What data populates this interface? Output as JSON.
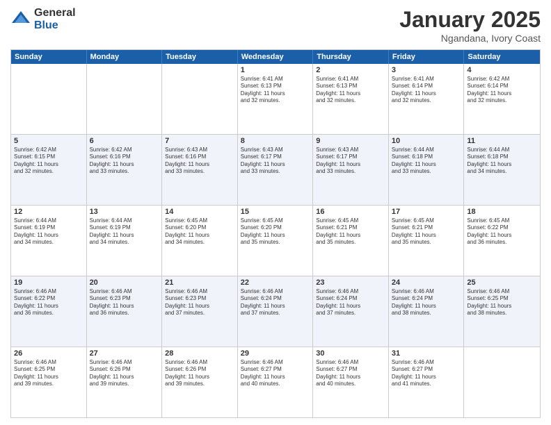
{
  "header": {
    "logo_general": "General",
    "logo_blue": "Blue",
    "month_title": "January 2025",
    "subtitle": "Ngandana, Ivory Coast"
  },
  "calendar": {
    "days_of_week": [
      "Sunday",
      "Monday",
      "Tuesday",
      "Wednesday",
      "Thursday",
      "Friday",
      "Saturday"
    ],
    "rows": [
      [
        {
          "day": "",
          "text": ""
        },
        {
          "day": "",
          "text": ""
        },
        {
          "day": "",
          "text": ""
        },
        {
          "day": "1",
          "text": "Sunrise: 6:41 AM\nSunset: 6:13 PM\nDaylight: 11 hours\nand 32 minutes."
        },
        {
          "day": "2",
          "text": "Sunrise: 6:41 AM\nSunset: 6:13 PM\nDaylight: 11 hours\nand 32 minutes."
        },
        {
          "day": "3",
          "text": "Sunrise: 6:41 AM\nSunset: 6:14 PM\nDaylight: 11 hours\nand 32 minutes."
        },
        {
          "day": "4",
          "text": "Sunrise: 6:42 AM\nSunset: 6:14 PM\nDaylight: 11 hours\nand 32 minutes."
        }
      ],
      [
        {
          "day": "5",
          "text": "Sunrise: 6:42 AM\nSunset: 6:15 PM\nDaylight: 11 hours\nand 32 minutes."
        },
        {
          "day": "6",
          "text": "Sunrise: 6:42 AM\nSunset: 6:16 PM\nDaylight: 11 hours\nand 33 minutes."
        },
        {
          "day": "7",
          "text": "Sunrise: 6:43 AM\nSunset: 6:16 PM\nDaylight: 11 hours\nand 33 minutes."
        },
        {
          "day": "8",
          "text": "Sunrise: 6:43 AM\nSunset: 6:17 PM\nDaylight: 11 hours\nand 33 minutes."
        },
        {
          "day": "9",
          "text": "Sunrise: 6:43 AM\nSunset: 6:17 PM\nDaylight: 11 hours\nand 33 minutes."
        },
        {
          "day": "10",
          "text": "Sunrise: 6:44 AM\nSunset: 6:18 PM\nDaylight: 11 hours\nand 33 minutes."
        },
        {
          "day": "11",
          "text": "Sunrise: 6:44 AM\nSunset: 6:18 PM\nDaylight: 11 hours\nand 34 minutes."
        }
      ],
      [
        {
          "day": "12",
          "text": "Sunrise: 6:44 AM\nSunset: 6:19 PM\nDaylight: 11 hours\nand 34 minutes."
        },
        {
          "day": "13",
          "text": "Sunrise: 6:44 AM\nSunset: 6:19 PM\nDaylight: 11 hours\nand 34 minutes."
        },
        {
          "day": "14",
          "text": "Sunrise: 6:45 AM\nSunset: 6:20 PM\nDaylight: 11 hours\nand 34 minutes."
        },
        {
          "day": "15",
          "text": "Sunrise: 6:45 AM\nSunset: 6:20 PM\nDaylight: 11 hours\nand 35 minutes."
        },
        {
          "day": "16",
          "text": "Sunrise: 6:45 AM\nSunset: 6:21 PM\nDaylight: 11 hours\nand 35 minutes."
        },
        {
          "day": "17",
          "text": "Sunrise: 6:45 AM\nSunset: 6:21 PM\nDaylight: 11 hours\nand 35 minutes."
        },
        {
          "day": "18",
          "text": "Sunrise: 6:45 AM\nSunset: 6:22 PM\nDaylight: 11 hours\nand 36 minutes."
        }
      ],
      [
        {
          "day": "19",
          "text": "Sunrise: 6:46 AM\nSunset: 6:22 PM\nDaylight: 11 hours\nand 36 minutes."
        },
        {
          "day": "20",
          "text": "Sunrise: 6:46 AM\nSunset: 6:23 PM\nDaylight: 11 hours\nand 36 minutes."
        },
        {
          "day": "21",
          "text": "Sunrise: 6:46 AM\nSunset: 6:23 PM\nDaylight: 11 hours\nand 37 minutes."
        },
        {
          "day": "22",
          "text": "Sunrise: 6:46 AM\nSunset: 6:24 PM\nDaylight: 11 hours\nand 37 minutes."
        },
        {
          "day": "23",
          "text": "Sunrise: 6:46 AM\nSunset: 6:24 PM\nDaylight: 11 hours\nand 37 minutes."
        },
        {
          "day": "24",
          "text": "Sunrise: 6:46 AM\nSunset: 6:24 PM\nDaylight: 11 hours\nand 38 minutes."
        },
        {
          "day": "25",
          "text": "Sunrise: 6:46 AM\nSunset: 6:25 PM\nDaylight: 11 hours\nand 38 minutes."
        }
      ],
      [
        {
          "day": "26",
          "text": "Sunrise: 6:46 AM\nSunset: 6:25 PM\nDaylight: 11 hours\nand 39 minutes."
        },
        {
          "day": "27",
          "text": "Sunrise: 6:46 AM\nSunset: 6:26 PM\nDaylight: 11 hours\nand 39 minutes."
        },
        {
          "day": "28",
          "text": "Sunrise: 6:46 AM\nSunset: 6:26 PM\nDaylight: 11 hours\nand 39 minutes."
        },
        {
          "day": "29",
          "text": "Sunrise: 6:46 AM\nSunset: 6:27 PM\nDaylight: 11 hours\nand 40 minutes."
        },
        {
          "day": "30",
          "text": "Sunrise: 6:46 AM\nSunset: 6:27 PM\nDaylight: 11 hours\nand 40 minutes."
        },
        {
          "day": "31",
          "text": "Sunrise: 6:46 AM\nSunset: 6:27 PM\nDaylight: 11 hours\nand 41 minutes."
        },
        {
          "day": "",
          "text": ""
        }
      ]
    ]
  }
}
